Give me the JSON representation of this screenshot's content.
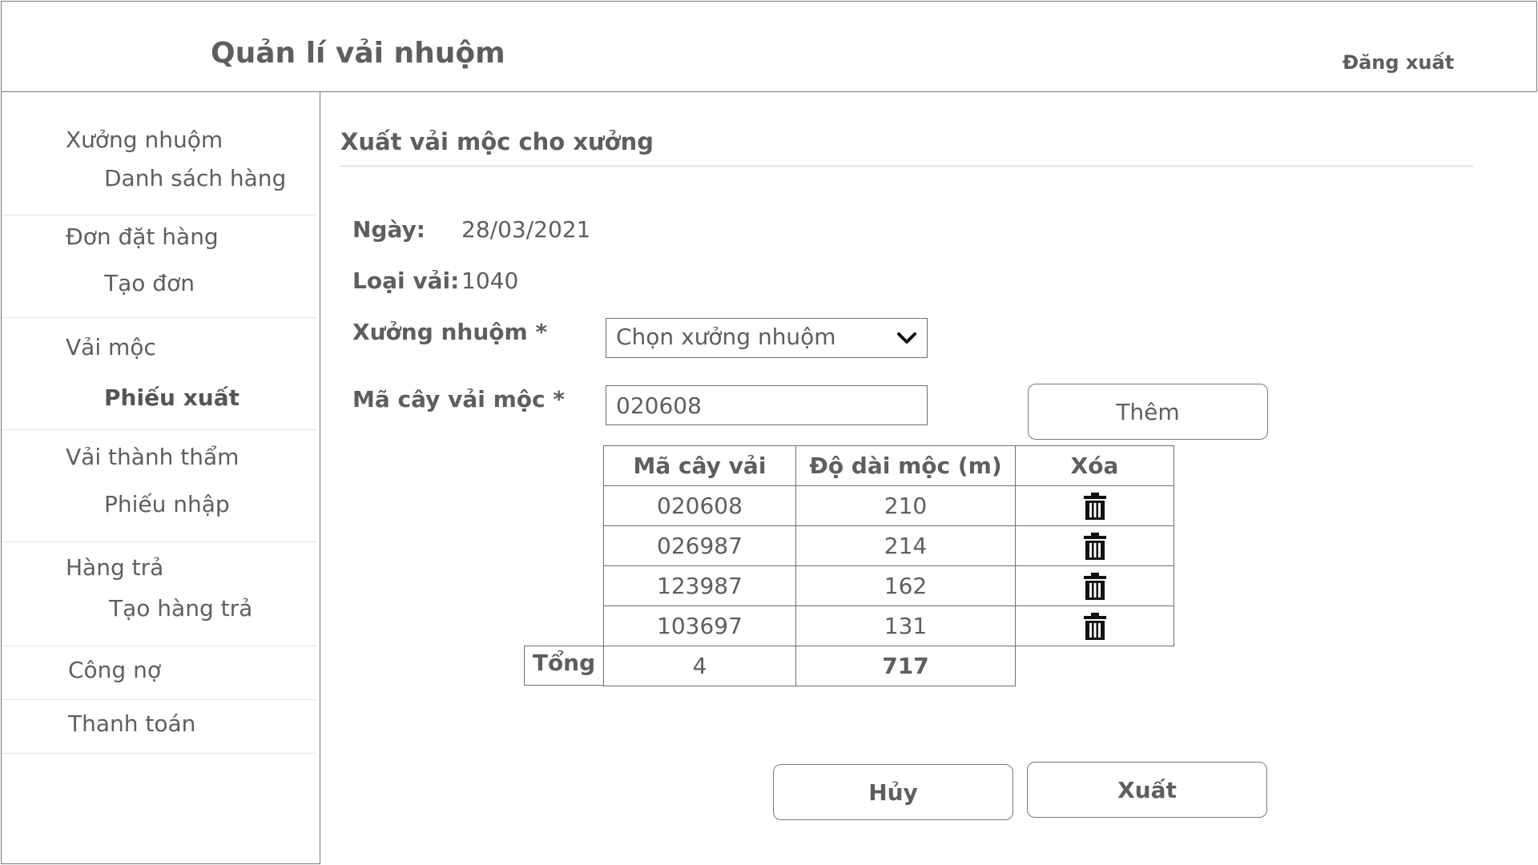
{
  "header": {
    "app_title": "Quản lí vải nhuộm",
    "logout_label": "Đăng xuất"
  },
  "sidebar": {
    "groups": [
      {
        "label": "Xưởng nhuộm",
        "sub": "Danh sách hàng"
      },
      {
        "label": "Đơn đặt hàng",
        "sub": "Tạo đơn"
      },
      {
        "label": "Vải mộc",
        "sub": "Phiếu xuất",
        "active": true
      },
      {
        "label": "Vải thành thẩm",
        "sub": "Phiếu nhập"
      },
      {
        "label": "Hàng trả",
        "sub": "Tạo hàng trả"
      },
      {
        "label": "Công nợ"
      },
      {
        "label": "Thanh toán"
      }
    ]
  },
  "main": {
    "title": "Xuất vải mộc cho xưởng",
    "date_label": "Ngày:",
    "date_value": "28/03/2021",
    "fabric_type_label": "Loại vải:",
    "fabric_type_value": "1040",
    "workshop_label": "Xưởng nhuộm *",
    "workshop_select": {
      "selected": "Chọn xưởng nhuộm"
    },
    "roll_code_label": "Mã cây vải mộc *",
    "roll_code_value": "020608",
    "add_button": "Thêm",
    "table": {
      "headers": [
        "Mã cây vải",
        "Độ dài mộc (m)",
        "Xóa"
      ],
      "rows": [
        {
          "code": "020608",
          "length": "210"
        },
        {
          "code": "026987",
          "length": "214"
        },
        {
          "code": "123987",
          "length": "162"
        },
        {
          "code": "103697",
          "length": "131"
        }
      ],
      "total_label": "Tổng",
      "total_count": "4",
      "total_length": "717"
    },
    "cancel_button": "Hủy",
    "export_button": "Xuất"
  },
  "icons": {
    "delete": "trash-icon",
    "dropdown": "chevron-down-icon"
  }
}
